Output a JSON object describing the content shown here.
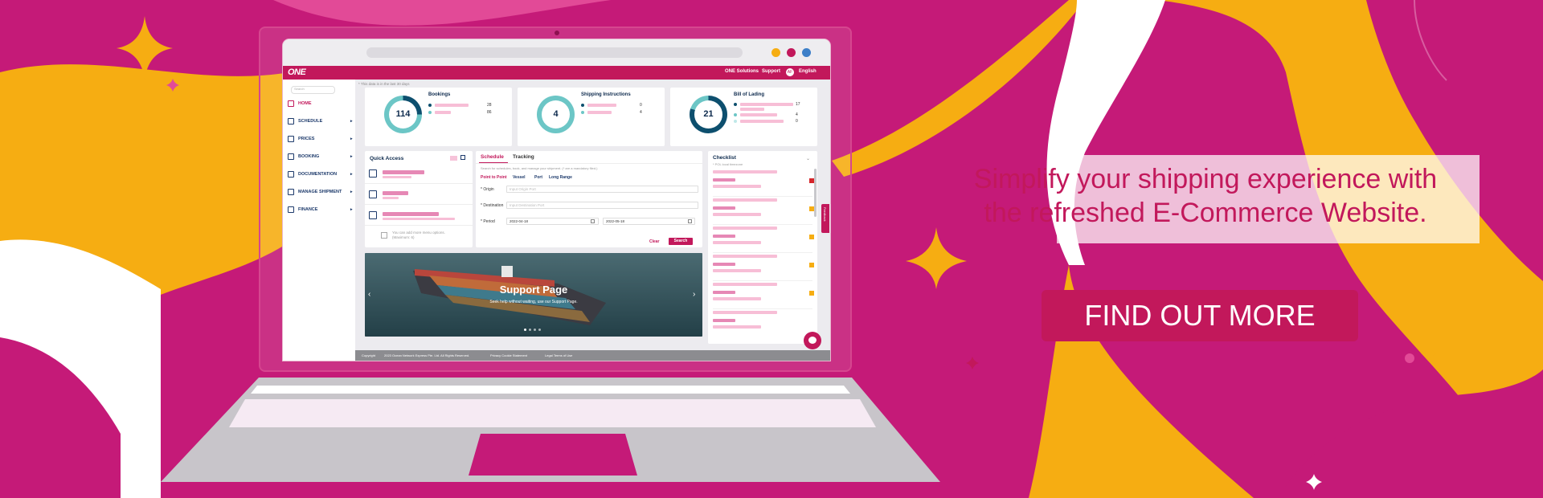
{
  "marketing": {
    "headline_line1": "Simplify your shipping experience with",
    "headline_line2": "the refreshed E-Commerce Website.",
    "cta_label": "FIND OUT MORE"
  },
  "colors": {
    "brand_magenta": "#c2185b",
    "background_magenta": "#c51a78",
    "accent_yellow": "#f6ad12",
    "navy": "#0d2a4d",
    "teal": "#6cc6c6"
  },
  "app": {
    "logo": "ONE",
    "topnav": {
      "solutions": "ONE Solutions",
      "support": "Support",
      "avatar": "AF",
      "language": "English"
    },
    "sidebar": {
      "search_placeholder": "Search",
      "items": [
        {
          "label": "HOME",
          "icon": "home-icon"
        },
        {
          "label": "SCHEDULE",
          "icon": "calendar-icon"
        },
        {
          "label": "PRICES",
          "icon": "prices-icon"
        },
        {
          "label": "BOOKING",
          "icon": "booking-icon"
        },
        {
          "label": "DOCUMENTATION",
          "icon": "document-icon"
        },
        {
          "label": "MANAGE SHIPMENT",
          "icon": "ship-icon"
        },
        {
          "label": "FINANCE",
          "icon": "finance-icon"
        }
      ]
    },
    "hint": "* This data is in the last 30 days",
    "stats": [
      {
        "title": "Bookings",
        "total": "114",
        "rows": [
          "28",
          "86"
        ]
      },
      {
        "title": "Shipping Instructions",
        "total": "4",
        "rows": [
          "0",
          "4"
        ]
      },
      {
        "title": "Bill of Lading",
        "total": "21",
        "rows": [
          "17",
          "4",
          "0"
        ]
      }
    ],
    "quick_access": {
      "title": "Quick Access",
      "note_line1": "You can add more menu options.",
      "note_line2": "(Maximum: 6)"
    },
    "schedule": {
      "tab_schedule": "Schedule",
      "tab_tracking": "Tracking",
      "description": "Search for schedules, book, and manage your shipment. (* are a mandatory filed.)",
      "modes": [
        "Point to Point",
        "Vessel",
        "Port",
        "Long Range"
      ],
      "origin_label": "* Origin",
      "origin_placeholder": "Input Origin Port",
      "destination_label": "* Destination",
      "destination_placeholder": "Input Destination Port",
      "period_label": "* Period",
      "period_from": "2022-04-18",
      "period_to": "2022-05-18",
      "clear": "Clear",
      "search": "Search"
    },
    "checklist": {
      "title": "Checklist",
      "subtitle": "* POL local timezone"
    },
    "banner": {
      "title": "Support Page",
      "subtitle": "Seek help without waiting, use our Support Page."
    },
    "feedback": "Feedback",
    "footer": {
      "copyright": "Copyright",
      "company": "2023 Ocean Network Express Pte. Ltd. All Rights Reserved.",
      "privacy": "Privacy Cookie Statement",
      "legal": "Legal Terms of Use"
    }
  }
}
